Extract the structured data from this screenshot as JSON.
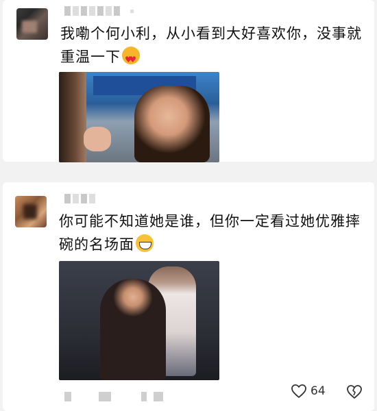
{
  "comments": [
    {
      "text": "我嘞个何小利，从小看到大好喜欢你，没事就重温一下",
      "emoji": "heart-eyes-emoji"
    },
    {
      "text": "你可能不知道她是谁，但你一定看过她优雅摔碗的名场面",
      "emoji": "grinning-emoji"
    }
  ],
  "footer": {
    "like_count": "64",
    "like_icon": "heart-outline-icon",
    "dislike_icon": "broken-heart-icon"
  },
  "colors": {
    "background": "#f2f2f2",
    "card": "#ffffff",
    "text": "#111111"
  }
}
